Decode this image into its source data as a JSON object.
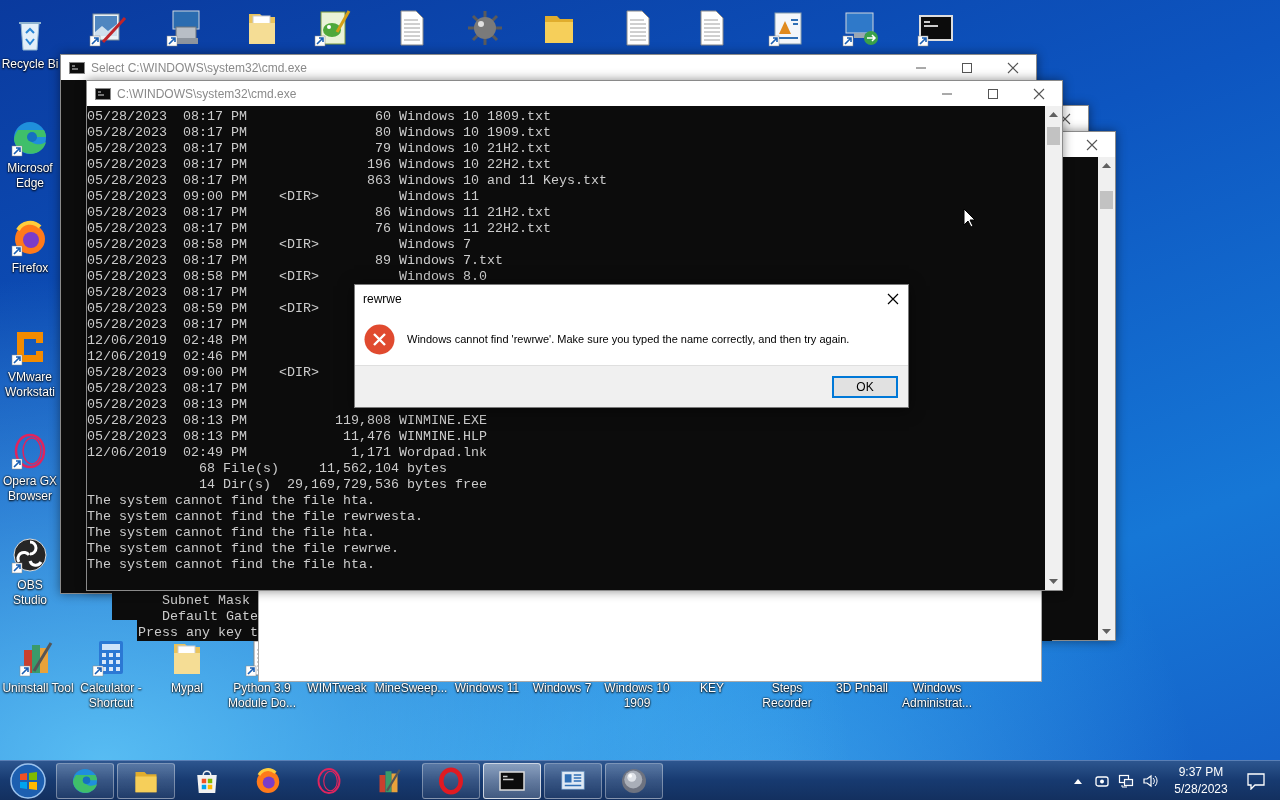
{
  "desktop_icons": [
    {
      "kind": "recycle",
      "label": "Recycle Bi",
      "shortcut": false
    },
    {
      "kind": "photo-pen",
      "shortcut": true
    },
    {
      "kind": "toolbox",
      "shortcut": true
    },
    {
      "kind": "folder-doc",
      "shortcut": false
    },
    {
      "kind": "notepad",
      "shortcut": true
    },
    {
      "kind": "document",
      "shortcut": false
    },
    {
      "kind": "mine",
      "shortcut": false
    },
    {
      "kind": "folder",
      "shortcut": false
    },
    {
      "kind": "document",
      "shortcut": false
    },
    {
      "kind": "document",
      "shortcut": false
    },
    {
      "kind": "wordpad",
      "shortcut": true
    },
    {
      "kind": "remote",
      "shortcut": true
    },
    {
      "kind": "console",
      "shortcut": true
    },
    {
      "kind": "edge",
      "label": "Microsof Edge",
      "shortcut": true
    },
    {
      "kind": "firefox",
      "label": "Firefox",
      "shortcut": true
    },
    {
      "kind": "vmware",
      "label": "VMware Workstati",
      "shortcut": true
    },
    {
      "kind": "opera-gx",
      "label": "Opera GX Browser",
      "shortcut": true
    },
    {
      "kind": "obs",
      "label": "OBS Studio",
      "shortcut": true
    },
    {
      "kind": "archive",
      "label": "Uninstall Tool",
      "shortcut": true
    },
    {
      "kind": "calculator",
      "label": "Calculator - Shortcut",
      "shortcut": true
    },
    {
      "kind": "folder-doc",
      "label": "Mypal",
      "shortcut": false
    },
    {
      "kind": "document",
      "label": "Python 3.9 Module Do...",
      "shortcut": true
    },
    {
      "label": "WIMTweak"
    },
    {
      "label": "MineSweep..."
    },
    {
      "label": "Windows 11"
    },
    {
      "label": "Windows 7"
    },
    {
      "label": "Windows 10 1909"
    },
    {
      "label": "KEY"
    },
    {
      "label": "Steps Recorder"
    },
    {
      "label": "3D Pnball"
    },
    {
      "label": "Windows Administrat..."
    }
  ],
  "select_window": {
    "title": "Select C:\\WINDOWS\\system32\\cmd.exe"
  },
  "console_behind": {
    "lines": [
      "   Subnet Mask",
      "   Default Gate",
      "Press any key t"
    ]
  },
  "cmd_window": {
    "title": "C:\\WINDOWS\\system32\\cmd.exe",
    "lines": [
      "05/28/2023  08:17 PM                60 Windows 10 1809.txt",
      "05/28/2023  08:17 PM                80 Windows 10 1909.txt",
      "05/28/2023  08:17 PM                79 Windows 10 21H2.txt",
      "05/28/2023  08:17 PM               196 Windows 10 22H2.txt",
      "05/28/2023  08:17 PM               863 Windows 10 and 11 Keys.txt",
      "05/28/2023  09:00 PM    <DIR>          Windows 11",
      "05/28/2023  08:17 PM                86 Windows 11 21H2.txt",
      "05/28/2023  08:17 PM                76 Windows 11 22H2.txt",
      "05/28/2023  08:58 PM    <DIR>          Windows 7",
      "05/28/2023  08:17 PM                89 Windows 7.txt",
      "05/28/2023  08:58 PM    <DIR>          Windows 8.0",
      "05/28/2023  08:17 PM",
      "05/28/2023  08:59 PM    <DIR>",
      "05/28/2023  08:17 PM",
      "12/06/2019  02:48 PM",
      "12/06/2019  02:46 PM",
      "05/28/2023  09:00 PM    <DIR>",
      "05/28/2023  08:17 PM",
      "05/28/2023  08:13 PM",
      "05/28/2023  08:13 PM           119,808 WINMINE.EXE",
      "05/28/2023  08:13 PM            11,476 WINMINE.HLP",
      "12/06/2019  02:49 PM             1,171 Wordpad.lnk",
      "              68 File(s)     11,562,104 bytes",
      "              14 Dir(s)  29,169,729,536 bytes free",
      "The system cannot find the file hta.",
      "The system cannot find the file rewrwesta.",
      "The system cannot find the file hta.",
      "The system cannot find the file rewrwe.",
      "The system cannot find the file hta."
    ]
  },
  "dialog": {
    "title": "rewrwe",
    "message": "Windows cannot find 'rewrwe'. Make sure you typed the name correctly, and then try again.",
    "button": "OK"
  },
  "taskbar": {
    "items": [
      {
        "kind": "edge",
        "running": true,
        "selected": false
      },
      {
        "kind": "folder",
        "running": true,
        "selected": false
      },
      {
        "kind": "store",
        "running": false,
        "selected": false
      },
      {
        "kind": "firefox",
        "running": false,
        "selected": false
      },
      {
        "kind": "opera-gx",
        "running": false,
        "selected": false
      },
      {
        "kind": "archive",
        "running": false,
        "selected": false
      },
      {
        "kind": "opera",
        "running": true,
        "selected": false
      },
      {
        "kind": "console",
        "running": true,
        "selected": true
      },
      {
        "kind": "steps",
        "running": true,
        "selected": false
      },
      {
        "kind": "pinball",
        "running": true,
        "selected": false
      }
    ],
    "tray": [
      {
        "kind": "caret"
      },
      {
        "kind": "camera"
      },
      {
        "kind": "network"
      },
      {
        "kind": "volume"
      }
    ],
    "clock": {
      "time": "9:37 PM",
      "date": "5/28/2023"
    }
  }
}
